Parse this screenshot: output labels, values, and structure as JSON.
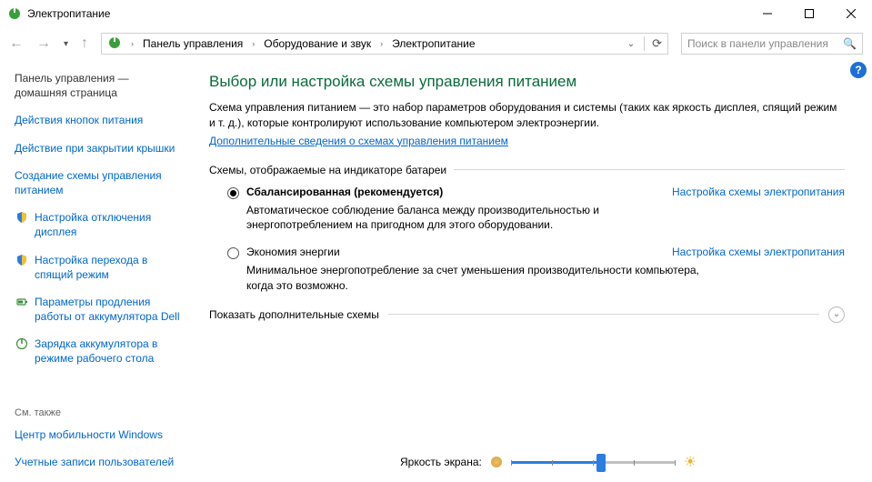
{
  "window": {
    "title": "Электропитание",
    "min_icon": "minimize",
    "max_icon": "maximize",
    "close_icon": "close"
  },
  "breadcrumbs": {
    "item0": "Панель управления",
    "item1": "Оборудование и звук",
    "item2": "Электропитание"
  },
  "search": {
    "placeholder": "Поиск в панели управления"
  },
  "sidebar": {
    "home": "Панель управления — домашняя страница",
    "link0": "Действия кнопок питания",
    "link1": "Действие при закрытии крышки",
    "link2": "Создание схемы управления питанием",
    "link3": "Настройка отключения дисплея",
    "link4": "Настройка перехода в спящий режим",
    "link5": "Параметры продления работы от аккумулятора Dell",
    "link6": "Зарядка аккумулятора в режиме рабочего стола",
    "see_also_label": "См. также",
    "see_also_0": "Центр мобильности Windows",
    "see_also_1": "Учетные записи пользователей"
  },
  "main": {
    "title": "Выбор или настройка схемы управления питанием",
    "desc": "Схема управления питанием — это набор параметров оборудования и системы (таких как яркость дисплея, спящий режим и т. д.), которые контролируют использование компьютером электроэнергии.",
    "more_link": "Дополнительные сведения о схемах управления питанием",
    "group_label": "Схемы, отображаемые на индикаторе батареи",
    "plan0": {
      "name": "Сбалансированная (рекомендуется)",
      "settings": "Настройка схемы электропитания",
      "desc": "Автоматическое соблюдение баланса между производительностью и энергопотреблением на пригодном для этого оборудовании."
    },
    "plan1": {
      "name": "Экономия энергии",
      "settings": "Настройка схемы электропитания",
      "desc": "Минимальное энергопотребление за счет уменьшения производительности компьютера, когда это возможно."
    },
    "expand_label": "Показать дополнительные схемы",
    "brightness_label": "Яркость экрана:"
  }
}
